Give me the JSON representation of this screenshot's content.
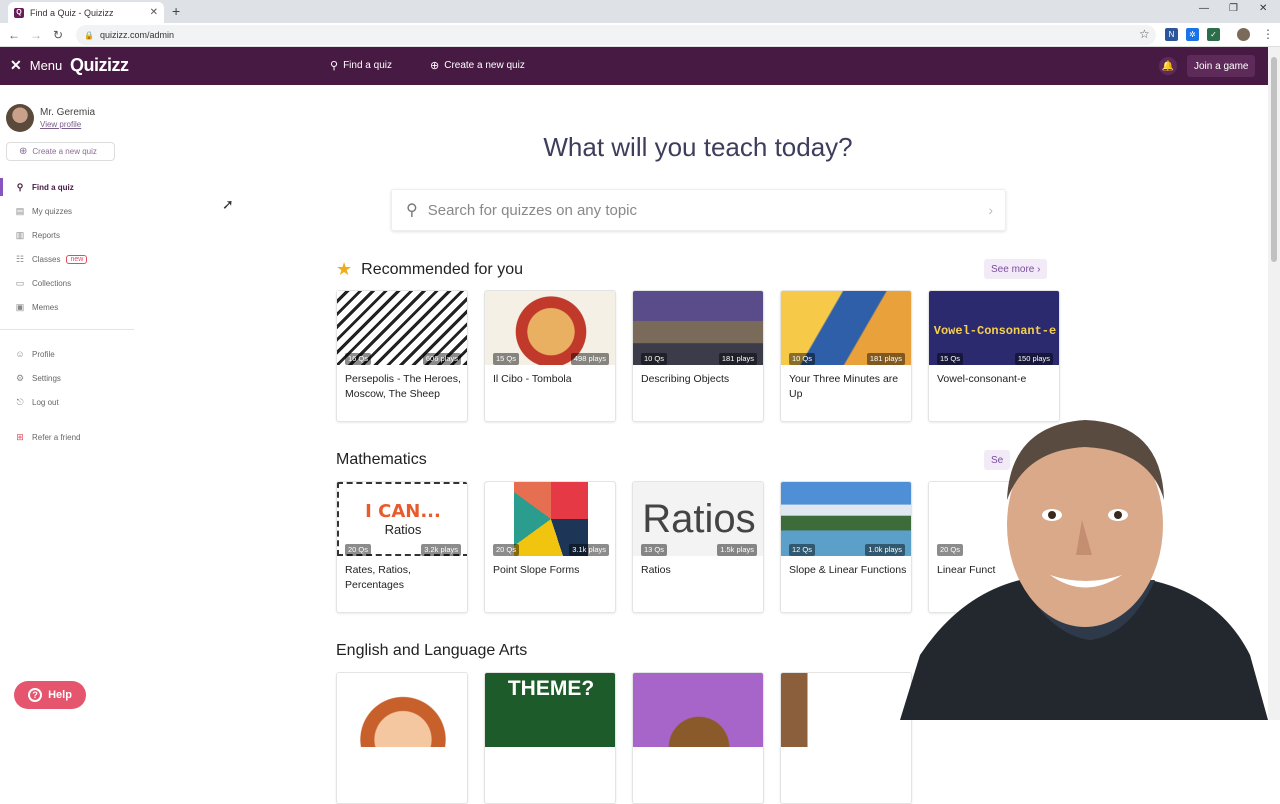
{
  "browser": {
    "tab_title": "Find a Quiz - Quizizz",
    "url": "quizizz.com/admin",
    "win_min": "—",
    "win_restore": "❐",
    "win_close": "✕"
  },
  "header": {
    "menu_label": "Menu",
    "logo": "Quizizz",
    "find_quiz": "Find a quiz",
    "create_quiz": "Create a new quiz",
    "join_game": "Join a game"
  },
  "sidebar": {
    "user_name": "Mr. Geremia",
    "view_profile": "View profile",
    "create_button": "Create a new quiz",
    "items": [
      {
        "label": "Find a quiz",
        "icon": "search-icon"
      },
      {
        "label": "My quizzes",
        "icon": "document-icon"
      },
      {
        "label": "Reports",
        "icon": "chart-icon"
      },
      {
        "label": "Classes",
        "icon": "classes-icon",
        "badge": "new"
      },
      {
        "label": "Collections",
        "icon": "folder-icon"
      },
      {
        "label": "Memes",
        "icon": "image-icon"
      },
      {
        "label": "Profile",
        "icon": "user-icon"
      },
      {
        "label": "Settings",
        "icon": "gear-icon"
      },
      {
        "label": "Log out",
        "icon": "logout-icon"
      },
      {
        "label": "Refer a friend",
        "icon": "gift-icon"
      }
    ],
    "help": "Help"
  },
  "main": {
    "headline": "What will you teach today?",
    "search_placeholder": "Search for quizzes on any topic",
    "see_more": "See more",
    "sections": [
      {
        "title": "Recommended for you",
        "cards": [
          {
            "qs": "16 Qs",
            "plays": "606 plays",
            "title": "Persepolis - The Heroes, Moscow, The Sheep"
          },
          {
            "qs": "15 Qs",
            "plays": "498 plays",
            "title": "Il Cibo - Tombola"
          },
          {
            "qs": "10 Qs",
            "plays": "181 plays",
            "title": "Describing Objects"
          },
          {
            "qs": "10 Qs",
            "plays": "181 plays",
            "title": "Your Three Minutes are Up"
          },
          {
            "qs": "15 Qs",
            "plays": "150 plays",
            "title": "Vowel-consonant-e",
            "thumb_text": "Vowel-Consonant-e"
          }
        ]
      },
      {
        "title": "Mathematics",
        "see_more_partial": "Se",
        "cards": [
          {
            "qs": "20 Qs",
            "plays": "3.2k plays",
            "title": "Rates, Ratios, Percentages",
            "thumb_text_1": "I CAN...",
            "thumb_text_2": "Ratios"
          },
          {
            "qs": "20 Qs",
            "plays": "3.1k plays",
            "title": "Point Slope Forms"
          },
          {
            "qs": "13 Qs",
            "plays": "1.5k plays",
            "title": "Ratios",
            "thumb_text": "Ratios"
          },
          {
            "qs": "12 Qs",
            "plays": "1.0k plays",
            "title": "Slope & Linear Functions"
          },
          {
            "qs": "20 Qs",
            "plays": "",
            "title": "Linear Funct"
          }
        ]
      },
      {
        "title": "English and Language Arts",
        "cards": [
          {
            "thumb_text": ""
          },
          {
            "thumb_text": "THEME?"
          },
          {
            "thumb_text": ""
          },
          {
            "thumb_text": ""
          }
        ]
      }
    ]
  },
  "colors": {
    "header_bg": "#461a42",
    "accent": "#8854c0",
    "help_bg": "#e5556d",
    "star": "#f0ad1a"
  }
}
